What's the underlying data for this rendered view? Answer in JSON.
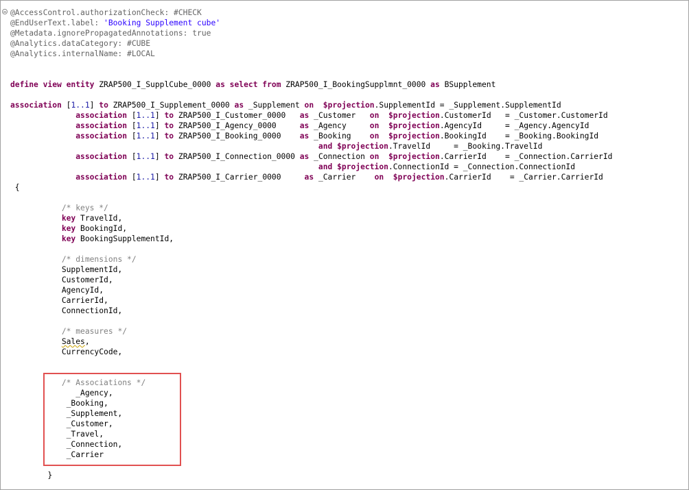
{
  "editor": {
    "colors": {
      "annotation": "#646464",
      "string": "#2a00ff",
      "keyword": "#7f0055",
      "comment": "#808080",
      "highlight_border": "#e15050"
    },
    "lines": [
      [
        {
          "t": "anno",
          "v": "@AccessControl.authorizationCheck: #CHECK"
        }
      ],
      [
        {
          "t": "anno",
          "v": "@EndUserText.label: "
        },
        {
          "t": "str",
          "v": "'Booking Supplement cube'"
        }
      ],
      [
        {
          "t": "anno",
          "v": "@Metadata.ignorePropagatedAnnotations: true"
        }
      ],
      [
        {
          "t": "anno",
          "v": "@Analytics.dataCategory: #CUBE"
        }
      ],
      [
        {
          "t": "anno",
          "v": "@Analytics.internalName: #LOCAL"
        }
      ],
      [],
      [],
      [
        {
          "t": "kw",
          "v": "define view entity"
        },
        {
          "t": "p",
          "v": " ZRAP500_I_SupplCube_0000 "
        },
        {
          "t": "kw",
          "v": "as select from"
        },
        {
          "t": "p",
          "v": " ZRAP500_I_BookingSupplmnt_0000 "
        },
        {
          "t": "kw",
          "v": "as"
        },
        {
          "t": "p",
          "v": " BSupplement"
        }
      ],
      [],
      [
        {
          "t": "kw",
          "v": "association"
        },
        {
          "t": "p",
          "v": " ["
        },
        {
          "t": "num",
          "v": "1..1"
        },
        {
          "t": "p",
          "v": "] "
        },
        {
          "t": "kw",
          "v": "to"
        },
        {
          "t": "p",
          "v": " ZRAP500_I_Supplement_0000 "
        },
        {
          "t": "kw",
          "v": "as"
        },
        {
          "t": "p",
          "v": " _Supplement "
        },
        {
          "t": "kw",
          "v": "on"
        },
        {
          "t": "p",
          "v": "  "
        },
        {
          "t": "kw",
          "v": "$projection"
        },
        {
          "t": "p",
          "v": ".SupplementId = _Supplement.SupplementId"
        }
      ],
      [
        {
          "t": "p",
          "v": "              "
        },
        {
          "t": "kw",
          "v": "association"
        },
        {
          "t": "p",
          "v": " ["
        },
        {
          "t": "num",
          "v": "1..1"
        },
        {
          "t": "p",
          "v": "] "
        },
        {
          "t": "kw",
          "v": "to"
        },
        {
          "t": "p",
          "v": " ZRAP500_I_Customer_0000   "
        },
        {
          "t": "kw",
          "v": "as"
        },
        {
          "t": "p",
          "v": " _Customer   "
        },
        {
          "t": "kw",
          "v": "on"
        },
        {
          "t": "p",
          "v": "  "
        },
        {
          "t": "kw",
          "v": "$projection"
        },
        {
          "t": "p",
          "v": ".CustomerId   = _Customer.CustomerId"
        }
      ],
      [
        {
          "t": "p",
          "v": "              "
        },
        {
          "t": "kw",
          "v": "association"
        },
        {
          "t": "p",
          "v": " ["
        },
        {
          "t": "num",
          "v": "1..1"
        },
        {
          "t": "p",
          "v": "] "
        },
        {
          "t": "kw",
          "v": "to"
        },
        {
          "t": "p",
          "v": " ZRAP500_I_Agency_0000     "
        },
        {
          "t": "kw",
          "v": "as"
        },
        {
          "t": "p",
          "v": " _Agency     "
        },
        {
          "t": "kw",
          "v": "on"
        },
        {
          "t": "p",
          "v": "  "
        },
        {
          "t": "kw",
          "v": "$projection"
        },
        {
          "t": "p",
          "v": ".AgencyId     = _Agency.AgencyId"
        }
      ],
      [
        {
          "t": "p",
          "v": "              "
        },
        {
          "t": "kw",
          "v": "association"
        },
        {
          "t": "p",
          "v": " ["
        },
        {
          "t": "num",
          "v": "1..1"
        },
        {
          "t": "p",
          "v": "] "
        },
        {
          "t": "kw",
          "v": "to"
        },
        {
          "t": "p",
          "v": " ZRAP500_I_Booking_0000    "
        },
        {
          "t": "kw",
          "v": "as"
        },
        {
          "t": "p",
          "v": " _Booking    "
        },
        {
          "t": "kw",
          "v": "on"
        },
        {
          "t": "p",
          "v": "  "
        },
        {
          "t": "kw",
          "v": "$projection"
        },
        {
          "t": "p",
          "v": ".BookingId    = _Booking.BookingId"
        }
      ],
      [
        {
          "t": "p",
          "v": "                                                                  "
        },
        {
          "t": "kw",
          "v": "and"
        },
        {
          "t": "p",
          "v": " "
        },
        {
          "t": "kw",
          "v": "$projection"
        },
        {
          "t": "p",
          "v": ".TravelId     = _Booking.TravelId"
        }
      ],
      [
        {
          "t": "p",
          "v": "              "
        },
        {
          "t": "kw",
          "v": "association"
        },
        {
          "t": "p",
          "v": " ["
        },
        {
          "t": "num",
          "v": "1..1"
        },
        {
          "t": "p",
          "v": "] "
        },
        {
          "t": "kw",
          "v": "to"
        },
        {
          "t": "p",
          "v": " ZRAP500_I_Connection_0000 "
        },
        {
          "t": "kw",
          "v": "as"
        },
        {
          "t": "p",
          "v": " _Connection "
        },
        {
          "t": "kw",
          "v": "on"
        },
        {
          "t": "p",
          "v": "  "
        },
        {
          "t": "kw",
          "v": "$projection"
        },
        {
          "t": "p",
          "v": ".CarrierId    = _Connection.CarrierId"
        }
      ],
      [
        {
          "t": "p",
          "v": "                                                                  "
        },
        {
          "t": "kw",
          "v": "and"
        },
        {
          "t": "p",
          "v": " "
        },
        {
          "t": "kw",
          "v": "$projection"
        },
        {
          "t": "p",
          "v": ".ConnectionId = _Connection.ConnectionId"
        }
      ],
      [
        {
          "t": "p",
          "v": "              "
        },
        {
          "t": "kw",
          "v": "association"
        },
        {
          "t": "p",
          "v": " ["
        },
        {
          "t": "num",
          "v": "1..1"
        },
        {
          "t": "p",
          "v": "] "
        },
        {
          "t": "kw",
          "v": "to"
        },
        {
          "t": "p",
          "v": " ZRAP500_I_Carrier_0000     "
        },
        {
          "t": "kw",
          "v": "as"
        },
        {
          "t": "p",
          "v": " _Carrier    "
        },
        {
          "t": "kw",
          "v": "on"
        },
        {
          "t": "p",
          "v": "  "
        },
        {
          "t": "kw",
          "v": "$projection"
        },
        {
          "t": "p",
          "v": ".CarrierId    = _Carrier.CarrierId"
        }
      ],
      [
        {
          "t": "p",
          "v": " {"
        }
      ],
      [],
      [
        {
          "t": "p",
          "v": "           "
        },
        {
          "t": "cmt",
          "v": "/* keys */"
        }
      ],
      [
        {
          "t": "p",
          "v": "           "
        },
        {
          "t": "kw",
          "v": "key"
        },
        {
          "t": "p",
          "v": " TravelId,"
        }
      ],
      [
        {
          "t": "p",
          "v": "           "
        },
        {
          "t": "kw",
          "v": "key"
        },
        {
          "t": "p",
          "v": " BookingId,"
        }
      ],
      [
        {
          "t": "p",
          "v": "           "
        },
        {
          "t": "kw",
          "v": "key"
        },
        {
          "t": "p",
          "v": " BookingSupplementId,"
        }
      ],
      [],
      [
        {
          "t": "p",
          "v": "           "
        },
        {
          "t": "cmt",
          "v": "/* dimensions */"
        }
      ],
      [
        {
          "t": "p",
          "v": "           SupplementId,"
        }
      ],
      [
        {
          "t": "p",
          "v": "           CustomerId,"
        }
      ],
      [
        {
          "t": "p",
          "v": "           AgencyId,"
        }
      ],
      [
        {
          "t": "p",
          "v": "           CarrierId,"
        }
      ],
      [
        {
          "t": "p",
          "v": "           ConnectionId,"
        }
      ],
      [],
      [
        {
          "t": "p",
          "v": "           "
        },
        {
          "t": "cmt",
          "v": "/* measures */"
        }
      ],
      [
        {
          "t": "p",
          "v": "           "
        },
        {
          "t": "sq",
          "v": "Sales"
        },
        {
          "t": "p",
          "v": ","
        }
      ],
      [
        {
          "t": "p",
          "v": "           CurrencyCode,"
        }
      ],
      [],
      [],
      [
        {
          "t": "p",
          "v": "           "
        },
        {
          "t": "cmt",
          "v": "/* Associations */"
        }
      ],
      [
        {
          "t": "p",
          "v": "              _Agency,"
        }
      ],
      [
        {
          "t": "p",
          "v": "            _Booking,"
        }
      ],
      [
        {
          "t": "p",
          "v": "            _Supplement,"
        }
      ],
      [
        {
          "t": "p",
          "v": "            _Customer,"
        }
      ],
      [
        {
          "t": "p",
          "v": "            _Travel,"
        }
      ],
      [
        {
          "t": "p",
          "v": "            _Connection,"
        }
      ],
      [
        {
          "t": "p",
          "v": "            _Carrier"
        }
      ],
      [],
      [
        {
          "t": "p",
          "v": "        }"
        }
      ]
    ]
  }
}
